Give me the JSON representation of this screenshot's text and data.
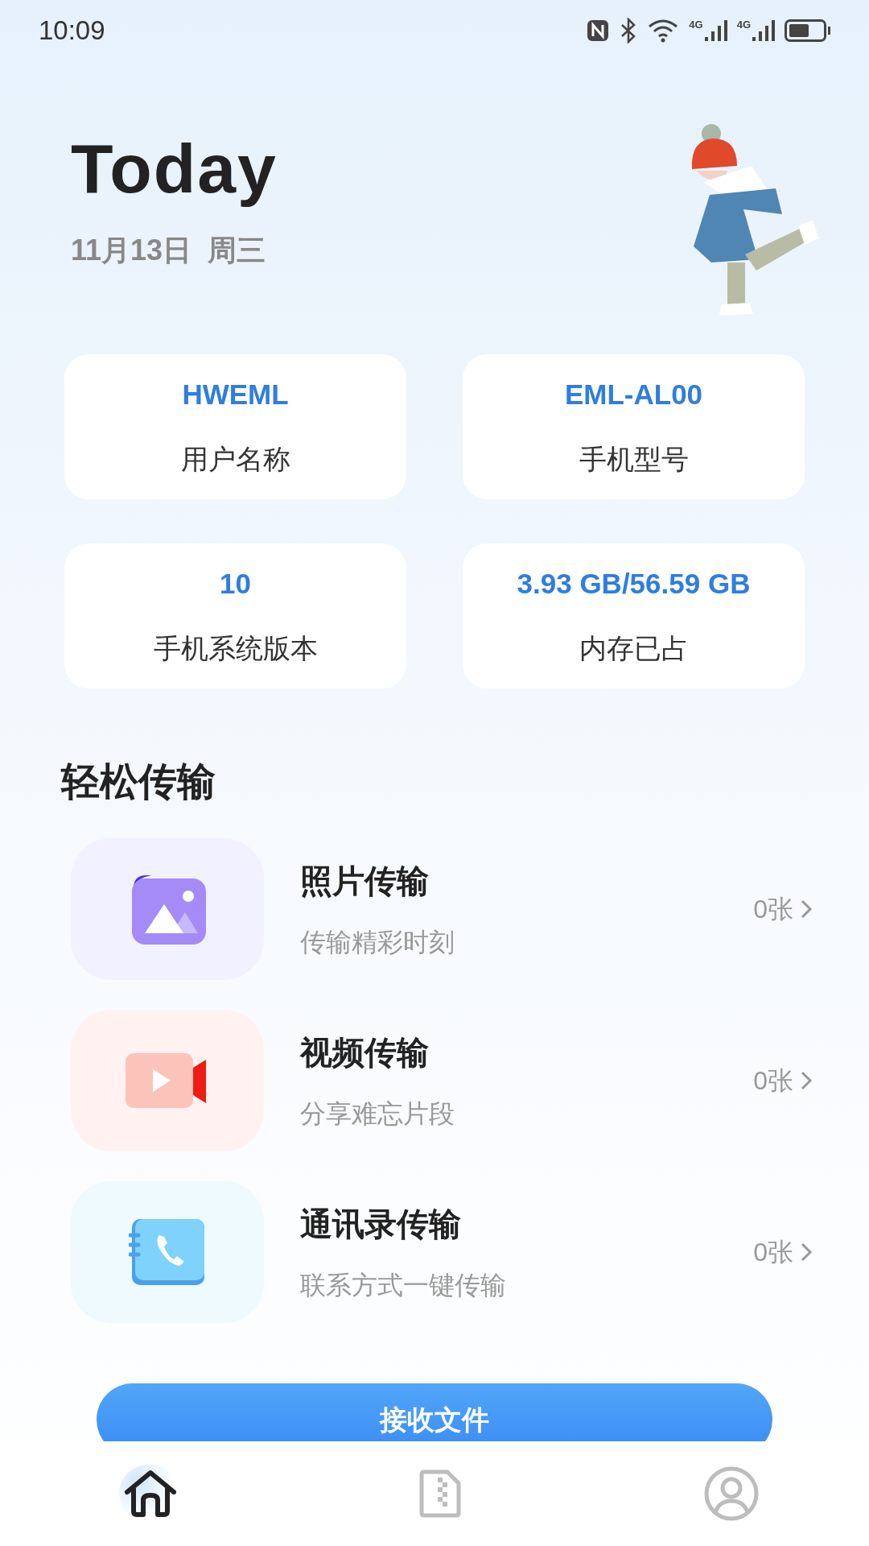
{
  "status_bar": {
    "time": "10:09",
    "network_labels": [
      "4G",
      "4G"
    ]
  },
  "header": {
    "title": "Today",
    "date": "11月13日  周三"
  },
  "info_cards": [
    {
      "value": "HWEML",
      "label": "用户名称"
    },
    {
      "value": "EML-AL00",
      "label": "手机型号"
    },
    {
      "value": "10",
      "label": "手机系统版本"
    },
    {
      "value": "3.93 GB/56.59 GB",
      "label": "内存已占"
    }
  ],
  "section_title": "轻松传输",
  "transfers": [
    {
      "kind": "photo",
      "title": "照片传输",
      "subtitle": "传输精彩时刻",
      "count": "0张",
      "color": "#f2f1ff"
    },
    {
      "kind": "video",
      "title": "视频传输",
      "subtitle": "分享难忘片段",
      "count": "0张",
      "color": "#fff2f1"
    },
    {
      "kind": "contacts",
      "title": "通讯录传输",
      "subtitle": "联系方式一键传输",
      "count": "0张",
      "color": "#eefaff"
    }
  ],
  "receive_button": "接收文件",
  "bottom_nav": [
    {
      "kind": "home",
      "selected": true
    },
    {
      "kind": "files",
      "selected": false
    },
    {
      "kind": "profile",
      "selected": false
    }
  ]
}
